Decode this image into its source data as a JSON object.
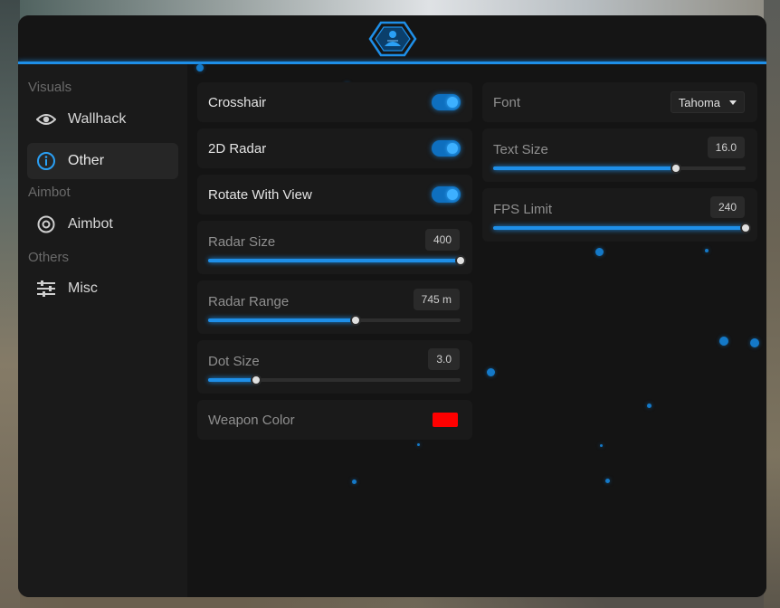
{
  "colors": {
    "accent": "#1e8fe8",
    "weapon_color": "#ff0000"
  },
  "header": {
    "logo_icon": "emblem-logo-icon"
  },
  "sidebar": {
    "sections": [
      {
        "label": "Visuals",
        "items": [
          {
            "label": "Wallhack",
            "icon": "eye-icon",
            "active": false
          },
          {
            "label": "Other",
            "icon": "info-icon",
            "active": true
          }
        ]
      },
      {
        "label": "Aimbot",
        "items": [
          {
            "label": "Aimbot",
            "icon": "target-icon",
            "active": false
          }
        ]
      },
      {
        "label": "Others",
        "items": [
          {
            "label": "Misc",
            "icon": "sliders-icon",
            "active": false
          }
        ]
      }
    ]
  },
  "left_column": {
    "crosshair": {
      "label": "Crosshair",
      "enabled": true
    },
    "radar_2d": {
      "label": "2D Radar",
      "enabled": true
    },
    "rotate_with_view": {
      "label": "Rotate With View",
      "enabled": true
    },
    "radar_size": {
      "label": "Radar Size",
      "value": "400",
      "fraction": 1.0
    },
    "radar_range": {
      "label": "Radar Range",
      "value": "745 m",
      "fraction": 0.585
    },
    "dot_size": {
      "label": "Dot Size",
      "value": "3.0",
      "fraction": 0.19
    },
    "weapon_color": {
      "label": "Weapon Color"
    }
  },
  "right_column": {
    "font": {
      "label": "Font",
      "selected": "Tahoma"
    },
    "text_size": {
      "label": "Text Size",
      "value": "16.0",
      "fraction": 0.725
    },
    "fps_limit": {
      "label": "FPS Limit",
      "value": "240",
      "fraction": 1.0
    }
  }
}
